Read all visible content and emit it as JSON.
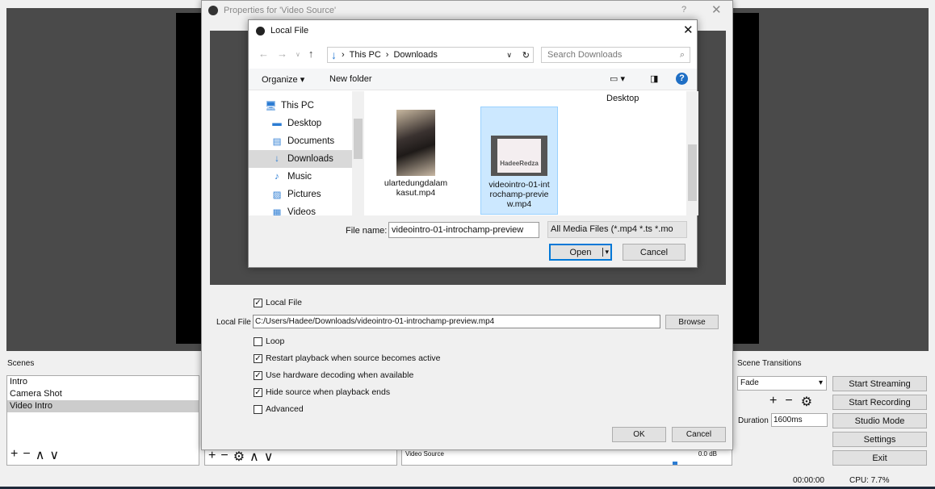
{
  "obs": {
    "scenes_label": "Scenes",
    "scenes": [
      "Intro",
      "Camera Shot",
      "Video Intro"
    ],
    "selected_scene": 2,
    "scene_transitions_label": "Scene Transitions",
    "transition": "Fade",
    "duration_label": "Duration",
    "duration": "1600ms",
    "buttons": {
      "start_streaming": "Start Streaming",
      "start_recording": "Start Recording",
      "studio_mode": "Studio Mode",
      "settings": "Settings",
      "exit": "Exit"
    },
    "mixer": {
      "source": "Video Source",
      "level": "0.0 dB"
    },
    "status": {
      "time": "00:00:00",
      "cpu": "CPU: 7.7%"
    }
  },
  "properties": {
    "title": "Properties for 'Video Source'",
    "help": "?",
    "local_file_checkbox": "Local File",
    "local_file_label": "Local File",
    "local_file_path": "C:/Users/Hadee/Downloads/videointro-01-introchamp-preview.mp4",
    "browse": "Browse",
    "options": [
      {
        "label": "Loop",
        "checked": false
      },
      {
        "label": "Restart playback when source becomes active",
        "checked": true
      },
      {
        "label": "Use hardware decoding when available",
        "checked": true
      },
      {
        "label": "Hide source when playback ends",
        "checked": true
      },
      {
        "label": "Advanced",
        "checked": false
      }
    ],
    "ok": "OK",
    "cancel": "Cancel"
  },
  "file_dialog": {
    "title": "Local File",
    "breadcrumb": [
      "This PC",
      "Downloads"
    ],
    "search_placeholder": "Search Downloads",
    "organize": "Organize",
    "new_folder": "New folder",
    "nav": [
      {
        "label": "This PC",
        "icon": "computer-icon"
      },
      {
        "label": "Desktop",
        "icon": "desktop-icon"
      },
      {
        "label": "Documents",
        "icon": "document-icon"
      },
      {
        "label": "Downloads",
        "icon": "download-icon"
      },
      {
        "label": "Music",
        "icon": "music-icon"
      },
      {
        "label": "Pictures",
        "icon": "pictures-icon"
      },
      {
        "label": "Videos",
        "icon": "videos-icon"
      }
    ],
    "selected_nav": 3,
    "desktop_header": "Desktop",
    "files": [
      {
        "name": "ulartedungdalam kasut.mp4",
        "selected": false
      },
      {
        "name": "videointro-01-int rochamp-previe w.mp4",
        "selected": true
      }
    ],
    "file_name_label": "File name:",
    "file_name": "videointro-01-introchamp-preview",
    "file_type": "All Media Files (*.mp4 *.ts *.mo",
    "open": "Open",
    "cancel": "Cancel",
    "thumb_text": "HadeeRedza"
  }
}
